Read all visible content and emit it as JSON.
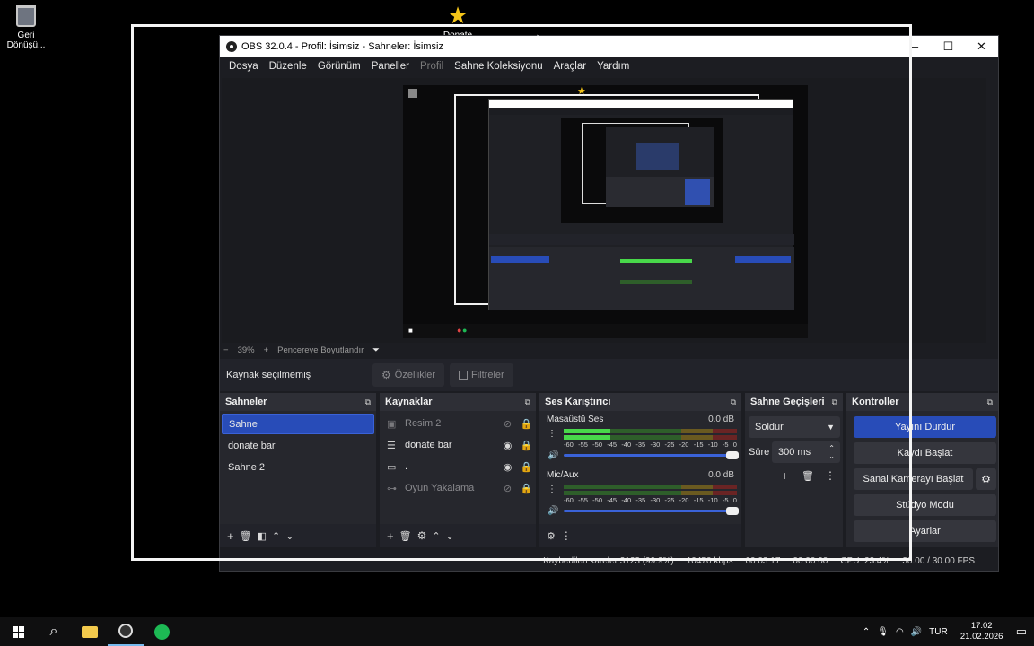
{
  "desktop": {
    "recycle_bin_label": "Geri Dönüşü...",
    "star_label": "Donate"
  },
  "window": {
    "title": "OBS 32.0.4 - Profil: İsimsiz - Sahneler: İsimsiz",
    "minimize": "–",
    "maximize": "☐",
    "close": "✕"
  },
  "menu": {
    "items": [
      "Dosya",
      "Düzenle",
      "Görünüm",
      "Paneller",
      "Profil",
      "Sahne Koleksiyonu",
      "Araçlar",
      "Yardım"
    ]
  },
  "zoom": {
    "minus": "−",
    "value": "39%",
    "plus": "+",
    "fit_label": "Pencereye Boyutlandır",
    "dropdown": "⏷"
  },
  "source_bar": {
    "no_source": "Kaynak seçilmemiş",
    "properties": "Özellikler",
    "filters": "Filtreler"
  },
  "scenes": {
    "title": "Sahneler",
    "items": [
      "Sahne",
      "donate bar",
      "Sahne 2"
    ],
    "selected": "Sahne"
  },
  "sources": {
    "title": "Kaynaklar",
    "items": [
      {
        "name": "Resim 2",
        "icon": "image-icon",
        "visible": false,
        "locked": true
      },
      {
        "name": "donate bar",
        "icon": "list-icon",
        "visible": true,
        "locked": true
      },
      {
        "name": ".",
        "icon": "monitor-icon",
        "visible": true,
        "locked": true
      },
      {
        "name": "Oyun Yakalama",
        "icon": "gamepad-icon",
        "visible": false,
        "locked": true
      }
    ]
  },
  "mixer": {
    "title": "Ses Karıştırıcı",
    "ticks": [
      "-60",
      "-55",
      "-50",
      "-45",
      "-40",
      "-35",
      "-30",
      "-25",
      "-20",
      "-15",
      "-10",
      "-5",
      "0"
    ],
    "channels": [
      {
        "name": "Masaüstü Ses",
        "db": "0.0 dB",
        "level": 0.27
      },
      {
        "name": "Mic/Aux",
        "db": "0.0 dB",
        "level": 0.0
      }
    ]
  },
  "transitions": {
    "title": "Sahne Geçişleri",
    "selected": "Soldur",
    "duration_label": "Süre",
    "duration_value": "300 ms"
  },
  "controls": {
    "title": "Kontroller",
    "stop_stream": "Yayını Durdur",
    "start_recording": "Kaydı Başlat",
    "virtual_camera": "Sanal Kamerayı Başlat",
    "studio_mode": "Stüdyo Modu",
    "settings": "Ayarlar"
  },
  "status": {
    "dropped_frames": "Kaybedilen kareler 3123 (99.9%)",
    "bitrate": "10470 kbps",
    "stream_time": "00:03:17",
    "rec_time": "00:00:00",
    "cpu": "CPU: 23.4%",
    "fps": "30.00 / 30.00 FPS"
  },
  "taskbar": {
    "language": "TUR",
    "time": "17:02",
    "date": "21.02.2026"
  }
}
